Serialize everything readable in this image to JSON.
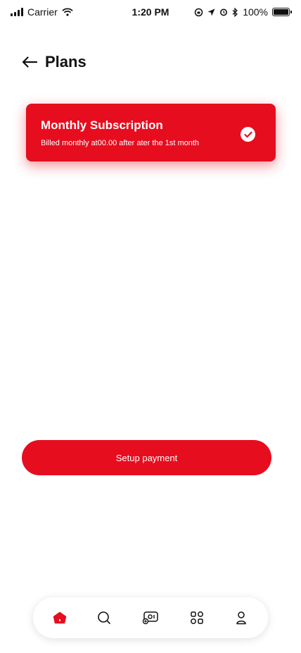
{
  "status_bar": {
    "carrier": "Carrier",
    "time": "1:20 PM",
    "battery": "100%"
  },
  "header": {
    "title": "Plans",
    "icons": {
      "back": "arrow-left-icon"
    }
  },
  "plan": {
    "title": "Monthly Subscription",
    "description": "Billed monthly at00.00 after ater the 1st month",
    "selected": true,
    "icon": "check-circle-icon"
  },
  "actions": {
    "setup_label": "Setup payment"
  },
  "bottom_nav": {
    "items": [
      {
        "icon": "home-icon",
        "active": true
      },
      {
        "icon": "search-icon",
        "active": false
      },
      {
        "icon": "media-add-icon",
        "active": false
      },
      {
        "icon": "grid-icon",
        "active": false
      },
      {
        "icon": "profile-icon",
        "active": false
      }
    ]
  },
  "colors": {
    "accent": "#e60d1f",
    "text": "#111111",
    "background": "#ffffff"
  }
}
